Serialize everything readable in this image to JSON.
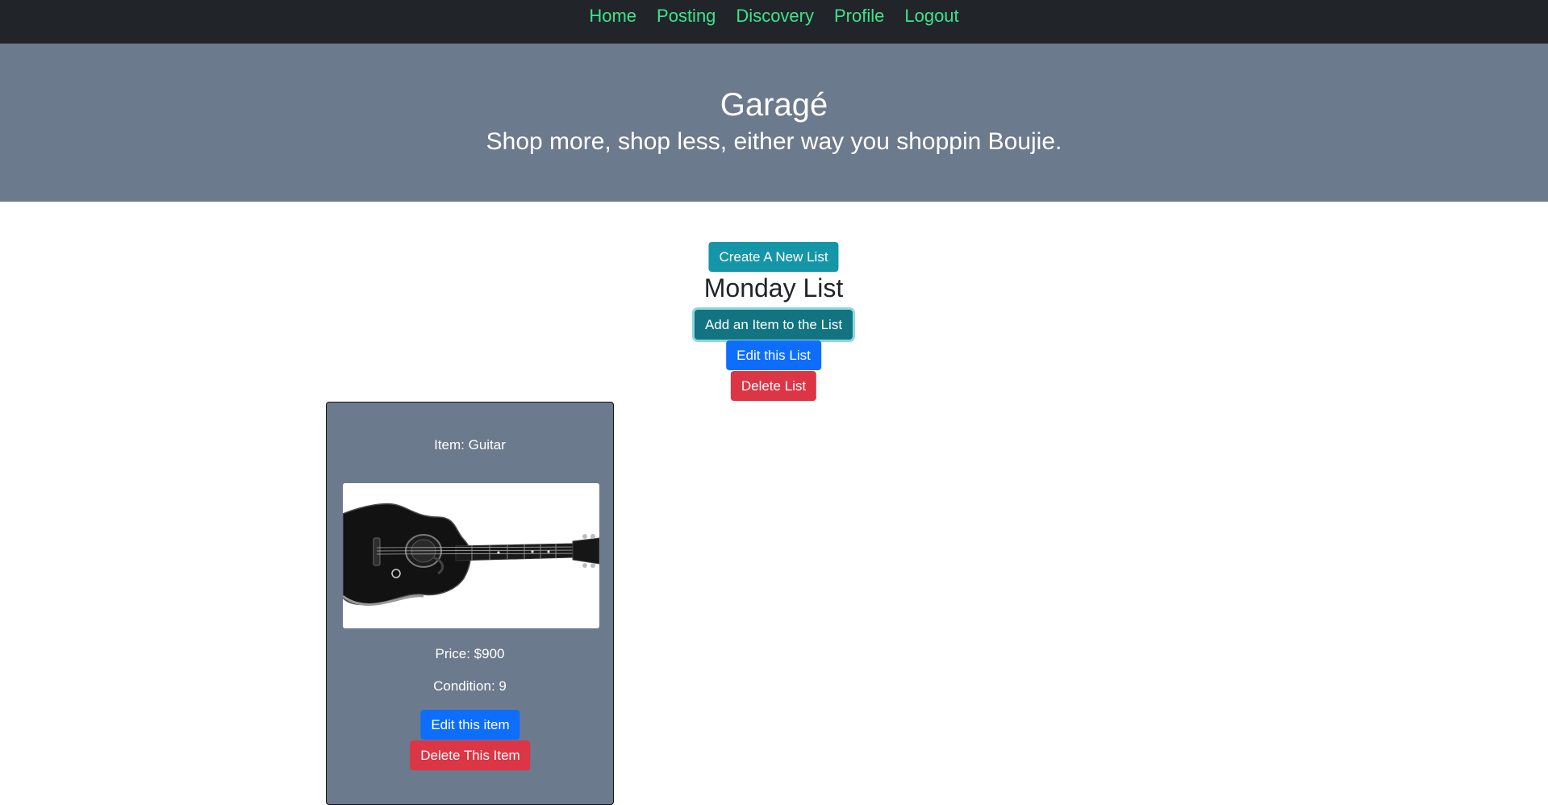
{
  "nav": {
    "items": [
      {
        "label": "Home"
      },
      {
        "label": "Posting"
      },
      {
        "label": "Discovery"
      },
      {
        "label": "Profile"
      },
      {
        "label": "Logout"
      }
    ]
  },
  "hero": {
    "title": "Garagé",
    "subtitle": "Shop more, shop less, either way you shoppin Boujie."
  },
  "list": {
    "create_label": "Create A New List",
    "title": "Monday List",
    "add_item_label": "Add an Item to the List",
    "edit_label": "Edit this List",
    "delete_label": "Delete List"
  },
  "item": {
    "name_text": "Item: Guitar",
    "price_text": "Price: $900",
    "condition_text": "Condition: 9",
    "edit_label": "Edit this item",
    "delete_label": "Delete This Item"
  },
  "colors": {
    "nav_bg": "#212529",
    "nav_link": "#3de38c",
    "hero_bg": "#6c7a8d",
    "info": "#1595a8",
    "primary": "#0d6efd",
    "danger": "#dc3545"
  }
}
